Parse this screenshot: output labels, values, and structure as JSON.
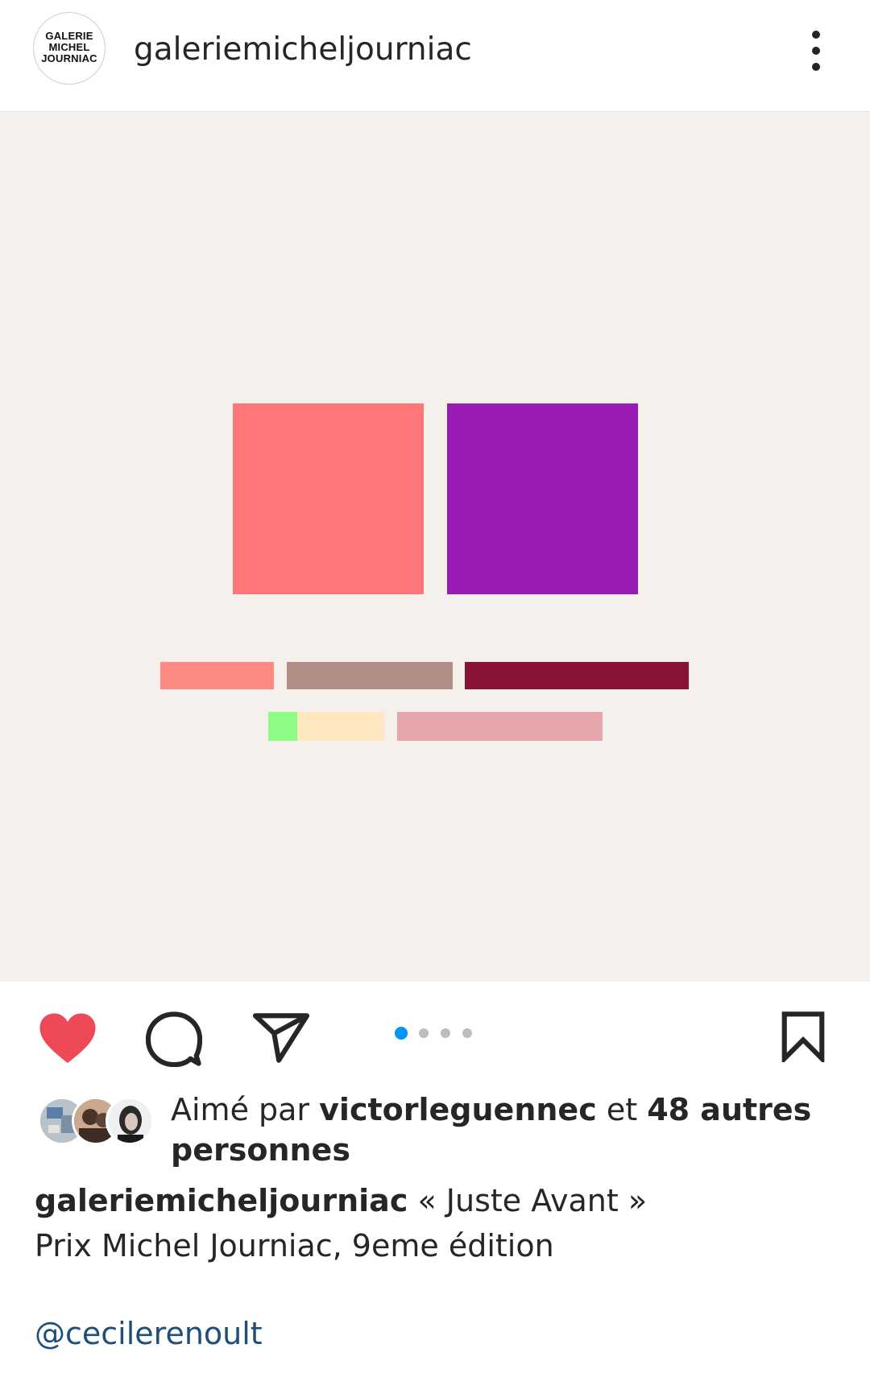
{
  "header": {
    "avatar_lines": [
      "GALERIE",
      "MICHEL",
      "JOURNIAC"
    ],
    "username": "galeriemicheljourniac",
    "more_icon": "more-vertical-icon"
  },
  "media": {
    "background": "#f5f0ec",
    "blocks": [
      "#ff7679",
      "#981cb3",
      "#fe8b83",
      "#b18f86",
      "#881337",
      "#8efb84",
      "#ffe7c0",
      "#e5a6ab"
    ]
  },
  "actions": {
    "like_icon": "heart-filled-icon",
    "like_color": "#ed4956",
    "comment_icon": "comment-icon",
    "share_icon": "send-icon",
    "save_icon": "bookmark-icon",
    "carousel": {
      "count": 4,
      "active": 1,
      "active_color": "#0095f6"
    }
  },
  "likes": {
    "prefix": "Aimé par",
    "user": "victorleguennec",
    "middle": "et",
    "others": "48 autres personnes"
  },
  "caption": {
    "username": "galeriemicheljourniac",
    "line1": "« Juste Avant »",
    "line2": "Prix Michel Journiac, 9eme édition",
    "mention": "@cecilerenoult"
  }
}
